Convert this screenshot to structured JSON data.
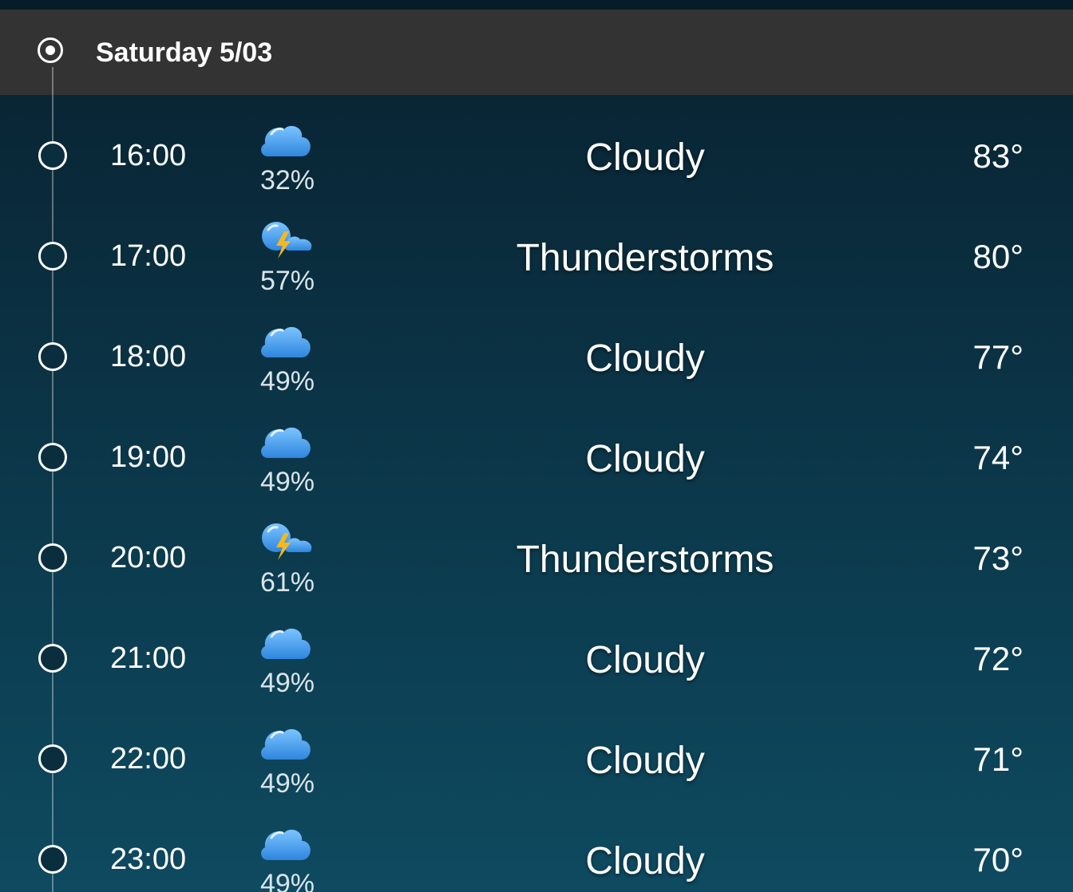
{
  "day_header": {
    "title": "Saturday 5/03"
  },
  "hours": [
    {
      "time": "16:00",
      "icon": "cloud-icon",
      "precip": "32%",
      "condition": "Cloudy",
      "temp": "83°"
    },
    {
      "time": "17:00",
      "icon": "thunderstorm-icon",
      "precip": "57%",
      "condition": "Thunderstorms",
      "temp": "80°"
    },
    {
      "time": "18:00",
      "icon": "cloud-icon",
      "precip": "49%",
      "condition": "Cloudy",
      "temp": "77°"
    },
    {
      "time": "19:00",
      "icon": "cloud-icon",
      "precip": "49%",
      "condition": "Cloudy",
      "temp": "74°"
    },
    {
      "time": "20:00",
      "icon": "thunderstorm-icon",
      "precip": "61%",
      "condition": "Thunderstorms",
      "temp": "73°"
    },
    {
      "time": "21:00",
      "icon": "cloud-icon",
      "precip": "49%",
      "condition": "Cloudy",
      "temp": "72°"
    },
    {
      "time": "22:00",
      "icon": "cloud-icon",
      "precip": "49%",
      "condition": "Cloudy",
      "temp": "71°"
    },
    {
      "time": "23:00",
      "icon": "cloud-icon",
      "precip": "49%",
      "condition": "Cloudy",
      "temp": "70°"
    }
  ],
  "colors": {
    "header_bg": "#333333",
    "cloud_blue": "#4a9fe8",
    "bolt_yellow": "#f5b820"
  }
}
